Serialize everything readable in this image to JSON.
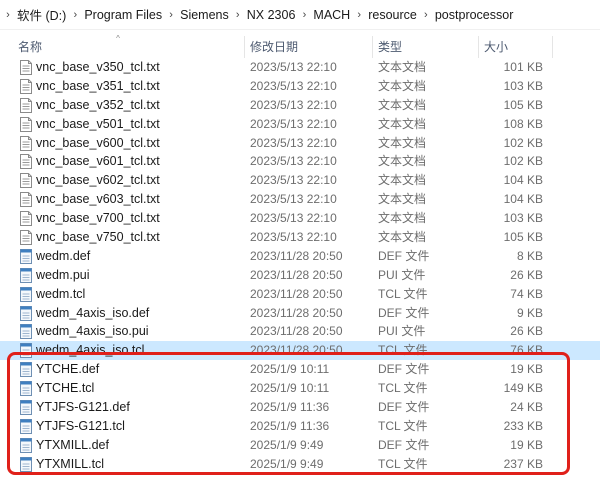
{
  "breadcrumb": {
    "items": [
      "软件 (D:)",
      "Program Files",
      "Siemens",
      "NX 2306",
      "MACH",
      "resource",
      "postprocessor"
    ]
  },
  "columns": {
    "name": "名称",
    "date": "修改日期",
    "type": "类型",
    "size": "大小"
  },
  "files": [
    {
      "name": "vnc_base_v350_tcl.txt",
      "date": "2023/5/13 22:10",
      "type": "文本文档",
      "size": "101 KB",
      "kind": "txt"
    },
    {
      "name": "vnc_base_v351_tcl.txt",
      "date": "2023/5/13 22:10",
      "type": "文本文档",
      "size": "103 KB",
      "kind": "txt"
    },
    {
      "name": "vnc_base_v352_tcl.txt",
      "date": "2023/5/13 22:10",
      "type": "文本文档",
      "size": "105 KB",
      "kind": "txt"
    },
    {
      "name": "vnc_base_v501_tcl.txt",
      "date": "2023/5/13 22:10",
      "type": "文本文档",
      "size": "108 KB",
      "kind": "txt"
    },
    {
      "name": "vnc_base_v600_tcl.txt",
      "date": "2023/5/13 22:10",
      "type": "文本文档",
      "size": "102 KB",
      "kind": "txt"
    },
    {
      "name": "vnc_base_v601_tcl.txt",
      "date": "2023/5/13 22:10",
      "type": "文本文档",
      "size": "102 KB",
      "kind": "txt"
    },
    {
      "name": "vnc_base_v602_tcl.txt",
      "date": "2023/5/13 22:10",
      "type": "文本文档",
      "size": "104 KB",
      "kind": "txt"
    },
    {
      "name": "vnc_base_v603_tcl.txt",
      "date": "2023/5/13 22:10",
      "type": "文本文档",
      "size": "104 KB",
      "kind": "txt"
    },
    {
      "name": "vnc_base_v700_tcl.txt",
      "date": "2023/5/13 22:10",
      "type": "文本文档",
      "size": "103 KB",
      "kind": "txt"
    },
    {
      "name": "vnc_base_v750_tcl.txt",
      "date": "2023/5/13 22:10",
      "type": "文本文档",
      "size": "105 KB",
      "kind": "txt"
    },
    {
      "name": "wedm.def",
      "date": "2023/11/28 20:50",
      "type": "DEF 文件",
      "size": "8 KB",
      "kind": "file"
    },
    {
      "name": "wedm.pui",
      "date": "2023/11/28 20:50",
      "type": "PUI 文件",
      "size": "26 KB",
      "kind": "file"
    },
    {
      "name": "wedm.tcl",
      "date": "2023/11/28 20:50",
      "type": "TCL 文件",
      "size": "74 KB",
      "kind": "file"
    },
    {
      "name": "wedm_4axis_iso.def",
      "date": "2023/11/28 20:50",
      "type": "DEF 文件",
      "size": "9 KB",
      "kind": "file"
    },
    {
      "name": "wedm_4axis_iso.pui",
      "date": "2023/11/28 20:50",
      "type": "PUI 文件",
      "size": "26 KB",
      "kind": "file"
    },
    {
      "name": "wedm_4axis_iso.tcl",
      "date": "2023/11/28 20:50",
      "type": "TCL 文件",
      "size": "76 KB",
      "kind": "file",
      "selected": true
    },
    {
      "name": "YTCHE.def",
      "date": "2025/1/9 10:11",
      "type": "DEF 文件",
      "size": "19 KB",
      "kind": "file"
    },
    {
      "name": "YTCHE.tcl",
      "date": "2025/1/9 10:11",
      "type": "TCL 文件",
      "size": "149 KB",
      "kind": "file"
    },
    {
      "name": "YTJFS-G121.def",
      "date": "2025/1/9 11:36",
      "type": "DEF 文件",
      "size": "24 KB",
      "kind": "file"
    },
    {
      "name": "YTJFS-G121.tcl",
      "date": "2025/1/9 11:36",
      "type": "TCL 文件",
      "size": "233 KB",
      "kind": "file"
    },
    {
      "name": "YTXMILL.def",
      "date": "2025/1/9 9:49",
      "type": "DEF 文件",
      "size": "19 KB",
      "kind": "file"
    },
    {
      "name": "YTXMILL.tcl",
      "date": "2025/1/9 9:49",
      "type": "TCL 文件",
      "size": "237 KB",
      "kind": "file"
    }
  ],
  "colors": {
    "selection": "#cce8ff",
    "highlight_border": "#e0201a",
    "header_text": "#4d5a70",
    "meta_text": "#6d6d6d"
  }
}
